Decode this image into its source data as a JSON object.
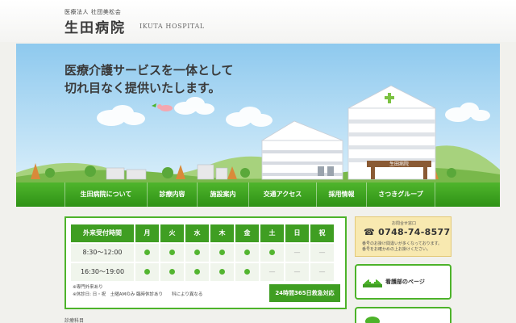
{
  "header": {
    "corporation": "医療法人 社団美松会",
    "name": "生田病院",
    "name_en": "IKUTA HOSPITAL"
  },
  "hero": {
    "line1": "医療介護サービスを一体として",
    "line2": "切れ目なく提供いたします。",
    "sign": "生田病院"
  },
  "nav": {
    "items": [
      {
        "label": "生田病院について"
      },
      {
        "label": "診療内容"
      },
      {
        "label": "施設案内"
      },
      {
        "label": "交通アクセス"
      },
      {
        "label": "採用情報"
      },
      {
        "label": "さつきグループ"
      }
    ]
  },
  "hours": {
    "header_label": "外来受付時間",
    "days": [
      "月",
      "火",
      "水",
      "木",
      "金",
      "土",
      "日",
      "祝"
    ],
    "rows": [
      {
        "time": "8:30〜12:00",
        "open": [
          true,
          true,
          true,
          true,
          true,
          true,
          false,
          false
        ]
      },
      {
        "time": "16:30〜19:00",
        "open": [
          true,
          true,
          true,
          true,
          true,
          false,
          false,
          false
        ]
      }
    ],
    "note1": "※専門外来あり",
    "note2": "※休診日: 日・祝　土曜AMのみ 臨時休診あり　　科により異なる",
    "emergency": "24時間365日救急対応"
  },
  "contact": {
    "label": "お問合せ窓口",
    "phone": "0748-74-8577",
    "note1": "番号のお掛け間違いが多くなっております。",
    "note2": "番号をお確かめの上お掛けください。"
  },
  "links": {
    "nursing": "看護部のページ"
  },
  "footer": {
    "text": "診療科目"
  },
  "colors": {
    "accent": "#3f9e22",
    "nav": "#4fb52c",
    "contact_bg": "#f8e9b0"
  }
}
